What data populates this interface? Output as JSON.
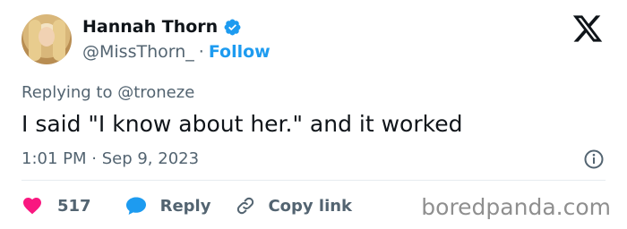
{
  "author": {
    "name": "Hannah Thorn",
    "handle": "@MissThorn_",
    "separator": "·",
    "follow_label": "Follow"
  },
  "reply_context": "Replying to @troneze",
  "tweet": {
    "text": "I said \"I know about her.\" and it worked",
    "timestamp": "1:01 PM · Sep 9, 2023"
  },
  "actions": {
    "likes_count": "517",
    "reply_label": "Reply",
    "copy_link_label": "Copy link"
  },
  "icons": {
    "verified": "verified-badge-icon",
    "x_logo": "x-logo-icon",
    "info": "info-icon",
    "heart": "heart-icon",
    "reply": "reply-bubble-icon",
    "link": "link-icon"
  },
  "colors": {
    "accent": "#1d9bf0",
    "like": "#f91880",
    "secondary_text": "#536471",
    "primary_text": "#0f1419"
  },
  "watermark": "boredpanda.com"
}
